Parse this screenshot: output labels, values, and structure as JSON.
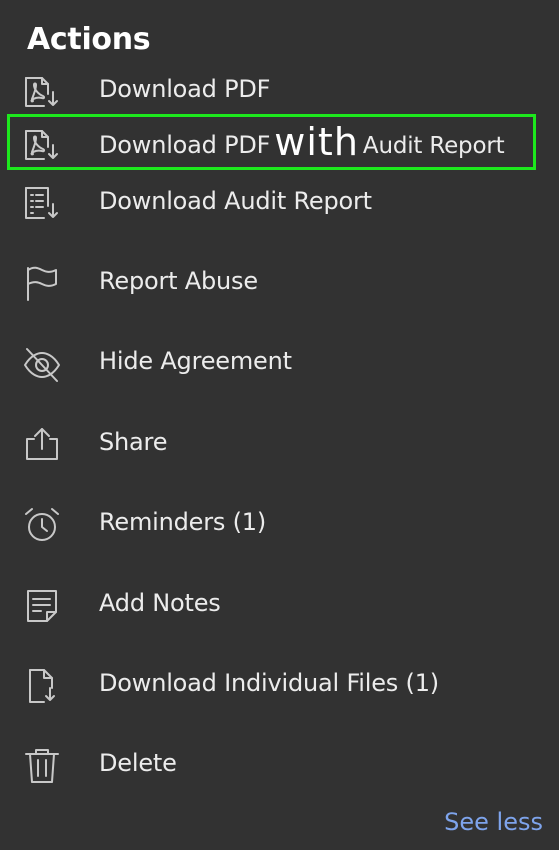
{
  "panel": {
    "title": "Actions",
    "see_less_label": "See less"
  },
  "items": [
    {
      "label": "Download PDF",
      "icon": "pdf-download-icon"
    },
    {
      "label_pre": "Download PDF",
      "label_with": "with",
      "label_post": "Audit Report",
      "icon": "pdf-download-icon",
      "highlighted": true
    },
    {
      "label": "Download Audit Report",
      "icon": "audit-report-download-icon"
    },
    {
      "label": "Report Abuse",
      "icon": "flag-icon"
    },
    {
      "label": "Hide Agreement",
      "icon": "eye-off-icon"
    },
    {
      "label": "Share",
      "icon": "share-icon"
    },
    {
      "label": "Reminders (1)",
      "icon": "alarm-clock-icon"
    },
    {
      "label": "Add Notes",
      "icon": "notes-icon"
    },
    {
      "label": "Download Individual Files (1)",
      "icon": "file-download-icon"
    },
    {
      "label": "Delete",
      "icon": "trash-icon"
    }
  ],
  "colors": {
    "background": "#323232",
    "text": "#ececec",
    "highlight_border": "#1de81d",
    "link": "#7ea4ec"
  }
}
